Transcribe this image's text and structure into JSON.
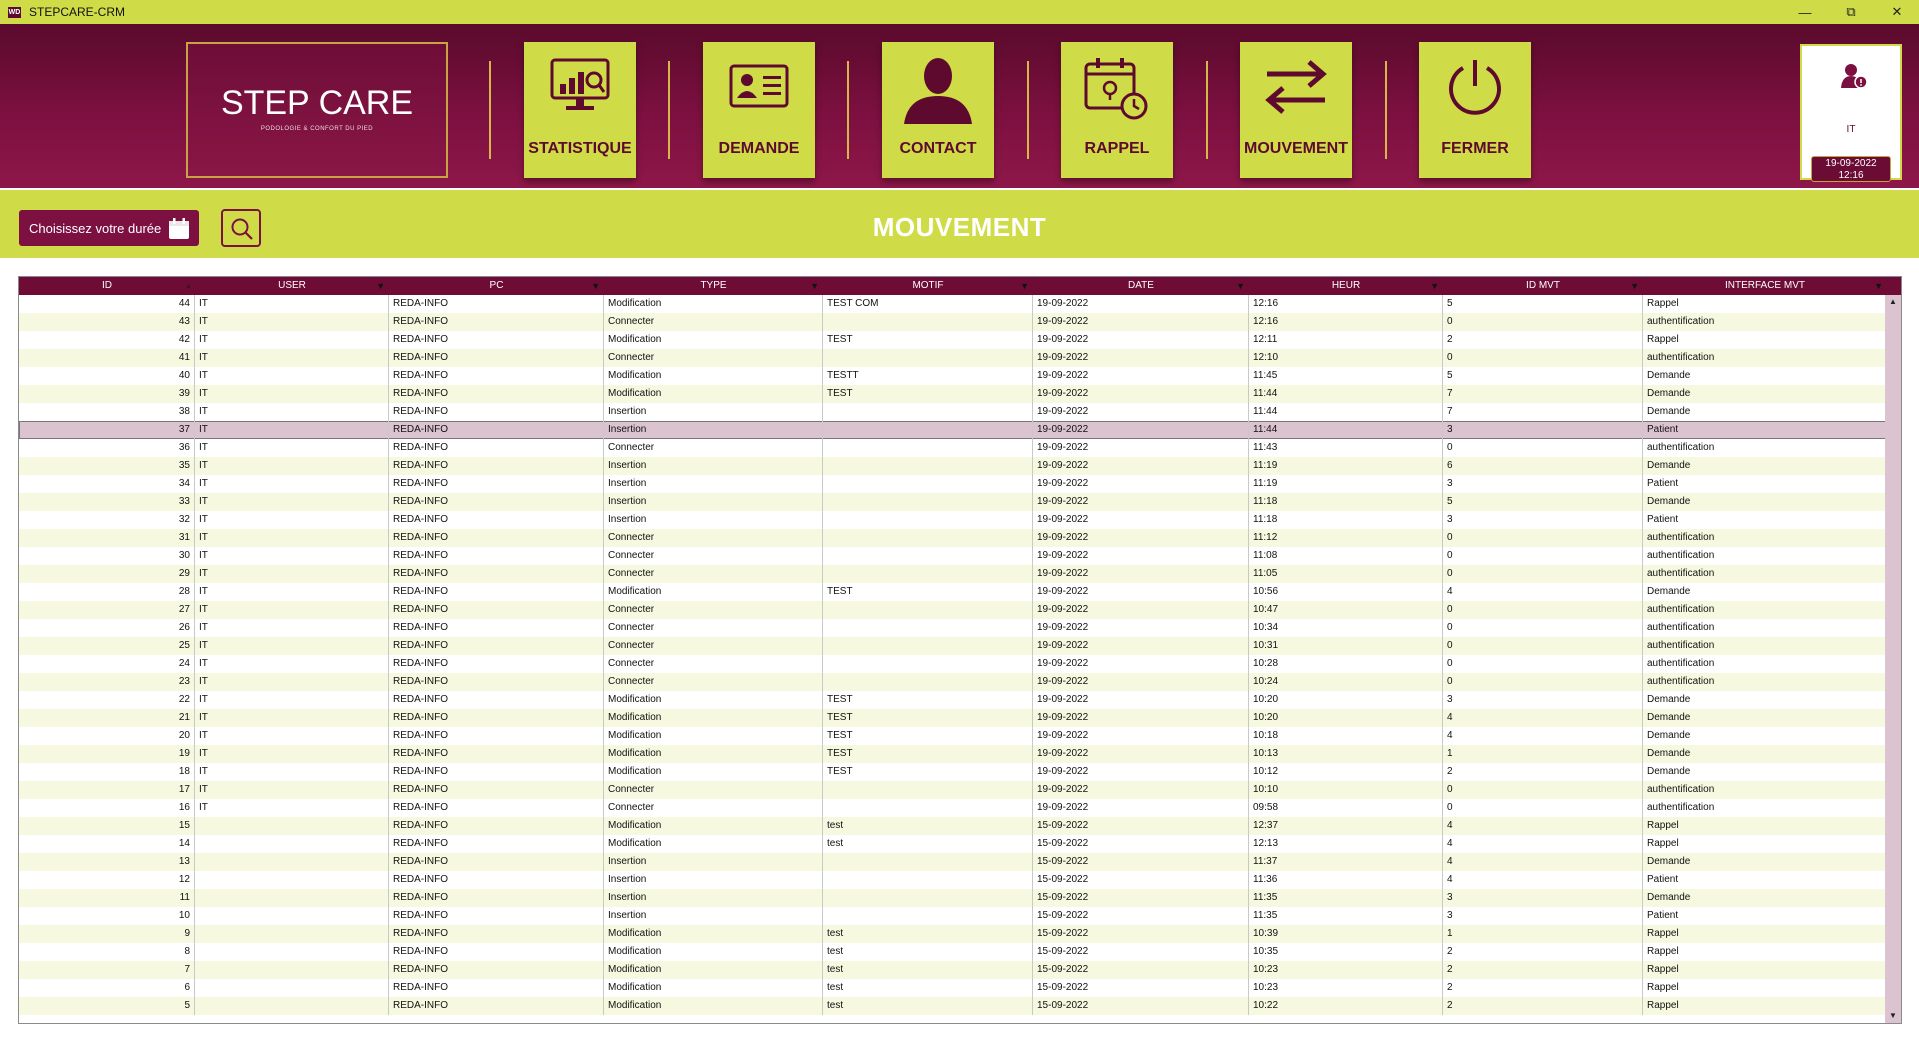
{
  "window": {
    "title": "STEPCARE-CRM",
    "icon_text": "WD"
  },
  "logo": {
    "main": "STEP CARE",
    "tagline": "PODOLOGIE & CONFORT DU PIED"
  },
  "nav": [
    {
      "label": "STATISTIQUE",
      "icon": "statistics-monitor-icon"
    },
    {
      "label": "DEMANDE",
      "icon": "id-card-icon"
    },
    {
      "label": "CONTACT",
      "icon": "person-silhouette-icon"
    },
    {
      "label": "RAPPEL",
      "icon": "calendar-clock-icon"
    },
    {
      "label": "MOUVEMENT",
      "icon": "arrows-exchange-icon"
    },
    {
      "label": "FERMER",
      "icon": "power-icon"
    }
  ],
  "user": {
    "name": "IT",
    "date": "19-09-2022",
    "time": "12:16"
  },
  "toolbar": {
    "duree_label": "Choisissez votre durée",
    "page_title": "MOUVEMENT"
  },
  "table": {
    "columns": [
      "ID",
      "USER",
      "PC",
      "TYPE",
      "MOTIF",
      "DATE",
      "HEUR",
      "ID MVT",
      "INTERFACE MVT"
    ],
    "selected_id": "37",
    "rows": [
      [
        "44",
        "IT",
        "REDA-INFO",
        "Modification",
        "TEST COM",
        "19-09-2022",
        "12:16",
        "5",
        "Rappel"
      ],
      [
        "43",
        "IT",
        "REDA-INFO",
        "Connecter",
        "",
        "19-09-2022",
        "12:16",
        "0",
        "authentification"
      ],
      [
        "42",
        "IT",
        "REDA-INFO",
        "Modification",
        "TEST",
        "19-09-2022",
        "12:11",
        "2",
        "Rappel"
      ],
      [
        "41",
        "IT",
        "REDA-INFO",
        "Connecter",
        "",
        "19-09-2022",
        "12:10",
        "0",
        "authentification"
      ],
      [
        "40",
        "IT",
        "REDA-INFO",
        "Modification",
        "TESTT",
        "19-09-2022",
        "11:45",
        "5",
        "Demande"
      ],
      [
        "39",
        "IT",
        "REDA-INFO",
        "Modification",
        "TEST",
        "19-09-2022",
        "11:44",
        "7",
        "Demande"
      ],
      [
        "38",
        "IT",
        "REDA-INFO",
        "Insertion",
        "",
        "19-09-2022",
        "11:44",
        "7",
        "Demande"
      ],
      [
        "37",
        "IT",
        "REDA-INFO",
        "Insertion",
        "",
        "19-09-2022",
        "11:44",
        "3",
        "Patient"
      ],
      [
        "36",
        "IT",
        "REDA-INFO",
        "Connecter",
        "",
        "19-09-2022",
        "11:43",
        "0",
        "authentification"
      ],
      [
        "35",
        "IT",
        "REDA-INFO",
        "Insertion",
        "",
        "19-09-2022",
        "11:19",
        "6",
        "Demande"
      ],
      [
        "34",
        "IT",
        "REDA-INFO",
        "Insertion",
        "",
        "19-09-2022",
        "11:19",
        "3",
        "Patient"
      ],
      [
        "33",
        "IT",
        "REDA-INFO",
        "Insertion",
        "",
        "19-09-2022",
        "11:18",
        "5",
        "Demande"
      ],
      [
        "32",
        "IT",
        "REDA-INFO",
        "Insertion",
        "",
        "19-09-2022",
        "11:18",
        "3",
        "Patient"
      ],
      [
        "31",
        "IT",
        "REDA-INFO",
        "Connecter",
        "",
        "19-09-2022",
        "11:12",
        "0",
        "authentification"
      ],
      [
        "30",
        "IT",
        "REDA-INFO",
        "Connecter",
        "",
        "19-09-2022",
        "11:08",
        "0",
        "authentification"
      ],
      [
        "29",
        "IT",
        "REDA-INFO",
        "Connecter",
        "",
        "19-09-2022",
        "11:05",
        "0",
        "authentification"
      ],
      [
        "28",
        "IT",
        "REDA-INFO",
        "Modification",
        "TEST",
        "19-09-2022",
        "10:56",
        "4",
        "Demande"
      ],
      [
        "27",
        "IT",
        "REDA-INFO",
        "Connecter",
        "",
        "19-09-2022",
        "10:47",
        "0",
        "authentification"
      ],
      [
        "26",
        "IT",
        "REDA-INFO",
        "Connecter",
        "",
        "19-09-2022",
        "10:34",
        "0",
        "authentification"
      ],
      [
        "25",
        "IT",
        "REDA-INFO",
        "Connecter",
        "",
        "19-09-2022",
        "10:31",
        "0",
        "authentification"
      ],
      [
        "24",
        "IT",
        "REDA-INFO",
        "Connecter",
        "",
        "19-09-2022",
        "10:28",
        "0",
        "authentification"
      ],
      [
        "23",
        "IT",
        "REDA-INFO",
        "Connecter",
        "",
        "19-09-2022",
        "10:24",
        "0",
        "authentification"
      ],
      [
        "22",
        "IT",
        "REDA-INFO",
        "Modification",
        "TEST",
        "19-09-2022",
        "10:20",
        "3",
        "Demande"
      ],
      [
        "21",
        "IT",
        "REDA-INFO",
        "Modification",
        "TEST",
        "19-09-2022",
        "10:20",
        "4",
        "Demande"
      ],
      [
        "20",
        "IT",
        "REDA-INFO",
        "Modification",
        "TEST",
        "19-09-2022",
        "10:18",
        "4",
        "Demande"
      ],
      [
        "19",
        "IT",
        "REDA-INFO",
        "Modification",
        "TEST",
        "19-09-2022",
        "10:13",
        "1",
        "Demande"
      ],
      [
        "18",
        "IT",
        "REDA-INFO",
        "Modification",
        "TEST",
        "19-09-2022",
        "10:12",
        "2",
        "Demande"
      ],
      [
        "17",
        "IT",
        "REDA-INFO",
        "Connecter",
        "",
        "19-09-2022",
        "10:10",
        "0",
        "authentification"
      ],
      [
        "16",
        "IT",
        "REDA-INFO",
        "Connecter",
        "",
        "19-09-2022",
        "09:58",
        "0",
        "authentification"
      ],
      [
        "15",
        "",
        "REDA-INFO",
        "Modification",
        "test",
        "15-09-2022",
        "12:37",
        "4",
        "Rappel"
      ],
      [
        "14",
        "",
        "REDA-INFO",
        "Modification",
        "test",
        "15-09-2022",
        "12:13",
        "4",
        "Rappel"
      ],
      [
        "13",
        "",
        "REDA-INFO",
        "Insertion",
        "",
        "15-09-2022",
        "11:37",
        "4",
        "Demande"
      ],
      [
        "12",
        "",
        "REDA-INFO",
        "Insertion",
        "",
        "15-09-2022",
        "11:36",
        "4",
        "Patient"
      ],
      [
        "11",
        "",
        "REDA-INFO",
        "Insertion",
        "",
        "15-09-2022",
        "11:35",
        "3",
        "Demande"
      ],
      [
        "10",
        "",
        "REDA-INFO",
        "Insertion",
        "",
        "15-09-2022",
        "11:35",
        "3",
        "Patient"
      ],
      [
        "9",
        "",
        "REDA-INFO",
        "Modification",
        "test",
        "15-09-2022",
        "10:39",
        "1",
        "Rappel"
      ],
      [
        "8",
        "",
        "REDA-INFO",
        "Modification",
        "test",
        "15-09-2022",
        "10:35",
        "2",
        "Rappel"
      ],
      [
        "7",
        "",
        "REDA-INFO",
        "Modification",
        "test",
        "15-09-2022",
        "10:23",
        "2",
        "Rappel"
      ],
      [
        "6",
        "",
        "REDA-INFO",
        "Modification",
        "test",
        "15-09-2022",
        "10:23",
        "2",
        "Rappel"
      ],
      [
        "5",
        "",
        "REDA-INFO",
        "Modification",
        "test",
        "15-09-2022",
        "10:22",
        "2",
        "Rappel"
      ]
    ]
  },
  "colors": {
    "burgundy": "#7c1040",
    "lime": "#cfdc48",
    "row_alt": "#f6f9df",
    "row_selected": "#dcc3d0"
  }
}
